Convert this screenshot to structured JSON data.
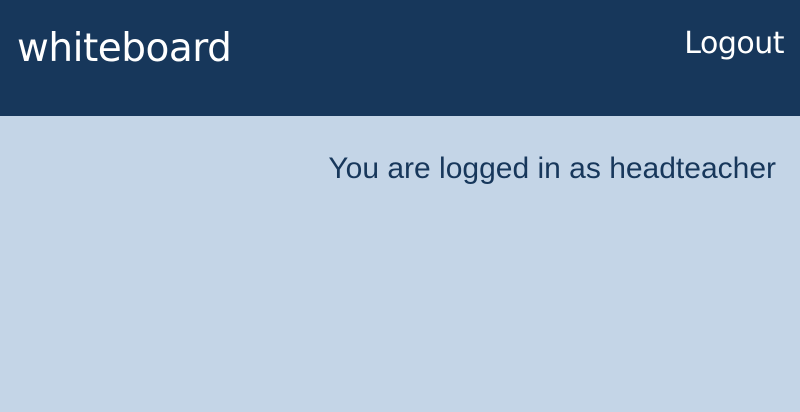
{
  "header": {
    "brand": "whiteboard",
    "logout_label": "Logout"
  },
  "main": {
    "status_text": "You are logged in as headteacher"
  },
  "colors": {
    "header_background": "#17375b",
    "page_background": "#c4d5e7",
    "header_text": "#ffffff",
    "body_text": "#17375b"
  }
}
